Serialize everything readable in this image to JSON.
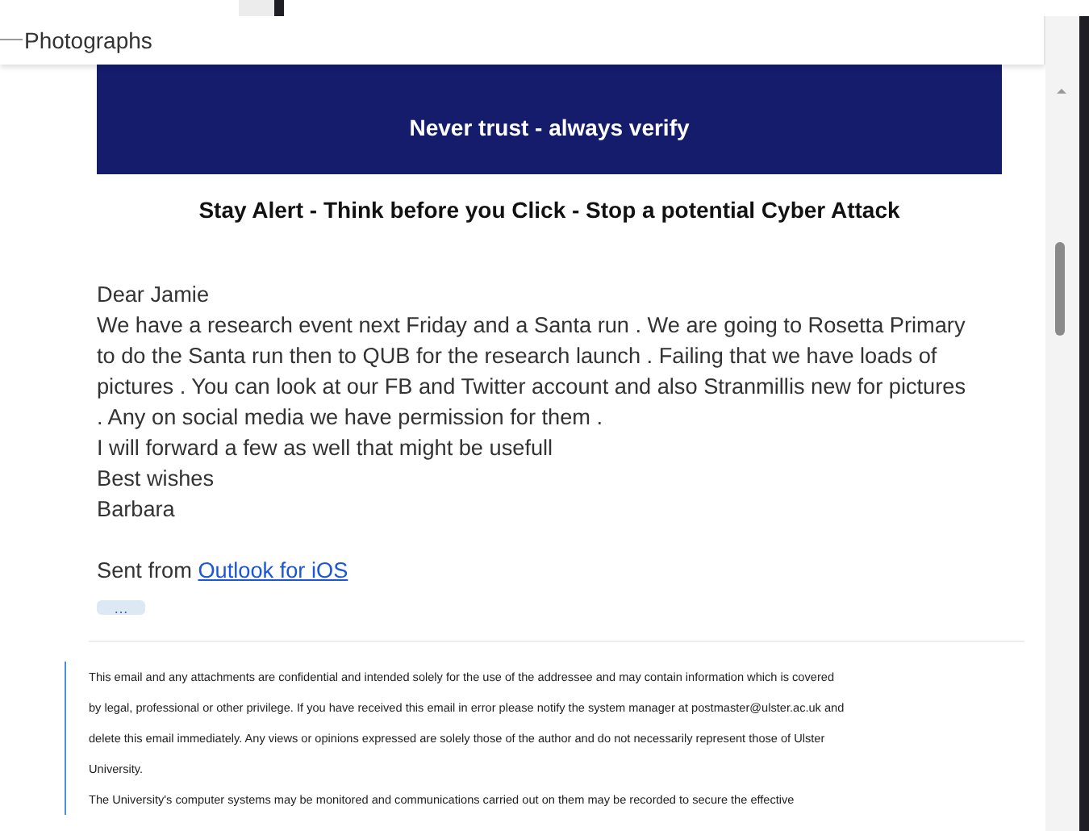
{
  "header": {
    "title": "Photographs"
  },
  "banner": {
    "text": "Never trust - always verify"
  },
  "alert": "Stay Alert - Think before you Click - Stop a potential Cyber Attack",
  "body_lines": [
    "Dear Jamie",
    "We have a research event next Friday and a Santa run . We are going to Rosetta Primary",
    "to do the Santa run then to QUB for the research launch . Failing that we have loads of",
    "pictures . You can look at our FB and Twitter account and also Stranmillis new for pictures",
    ". Any on social media we have permission for them .",
    "I will forward a few as well that might be usefull",
    "Best wishes",
    "Barbara"
  ],
  "signature": {
    "prefix": "Sent from ",
    "link": "Outlook for iOS"
  },
  "more_button": "…",
  "disclaimer": [
    [
      "This email and any attachments are confidential and intended solely for the use of the addressee and may contain information which is covered",
      "by legal, professional or other privilege. If you have received this email in error please notify the system manager at postmaster@ulster.ac.uk and",
      "delete this email immediately. Any views or opinions expressed are solely those of the author and do not necessarily represent those of Ulster",
      "University."
    ],
    [
      "The University's computer systems may be monitored and communications carried out on them may be recorded to secure the effective"
    ]
  ]
}
